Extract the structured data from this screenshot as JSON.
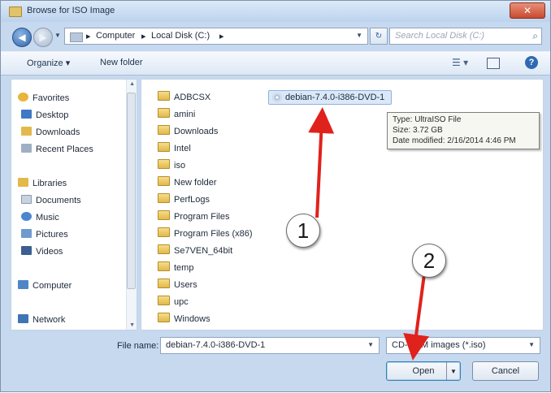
{
  "window": {
    "title": "Browse for ISO Image",
    "close_glyph": "✕"
  },
  "addressbar": {
    "back_glyph": "◀",
    "forward_glyph": "▶",
    "breadcrumbs": [
      "Computer",
      "Local Disk (C:)"
    ],
    "separator": "▸",
    "search_placeholder": "Search Local Disk (C:)"
  },
  "toolbar": {
    "organize": "Organize ▾",
    "new_folder": "New folder",
    "help": "?"
  },
  "nav": {
    "items": [
      {
        "label": "Favorites",
        "icon": "star-icon",
        "color": "#e8b43a"
      },
      {
        "label": "Desktop",
        "icon": "desktop-icon",
        "color": "#3f78c4"
      },
      {
        "label": "Downloads",
        "icon": "downloads-icon",
        "color": "#e2b94a"
      },
      {
        "label": "Recent Places",
        "icon": "recent-places-icon",
        "color": "#9fb0c4"
      },
      {
        "label": "Libraries",
        "icon": "libraries-icon",
        "color": "#e2b94a"
      },
      {
        "label": "Documents",
        "icon": "documents-icon",
        "color": "#c9d3df"
      },
      {
        "label": "Music",
        "icon": "music-icon",
        "color": "#4a87cf"
      },
      {
        "label": "Pictures",
        "icon": "pictures-icon",
        "color": "#6f9ad0"
      },
      {
        "label": "Videos",
        "icon": "videos-icon",
        "color": "#3c5f8f"
      },
      {
        "label": "Computer",
        "icon": "computer-icon",
        "color": "#4e86c6"
      },
      {
        "label": "Network",
        "icon": "network-icon",
        "color": "#3f74b5"
      }
    ]
  },
  "files": {
    "folders": [
      "ADBCSX",
      "amini",
      "Downloads",
      "Intel",
      "iso",
      "New folder",
      "PerfLogs",
      "Program Files",
      "Program Files (x86)",
      "Se7VEN_64bit",
      "temp",
      "Users",
      "upc",
      "Windows"
    ],
    "iso_file": "debian-7.4.0-i386-DVD-1",
    "tooltip": [
      "Type: UltraISO File",
      "Size: 3.72 GB",
      "Date modified: 2/16/2014 4:46 PM"
    ]
  },
  "footer": {
    "file_name_label": "File name:",
    "file_name_value": "debian-7.4.0-i386-DVD-1",
    "filter_value": "CD-ROM images (*.iso)",
    "open_label": "Open",
    "cancel_label": "Cancel"
  },
  "annotations": {
    "callout_1": "1",
    "callout_2": "2",
    "arrow_color": "#e0221c"
  }
}
